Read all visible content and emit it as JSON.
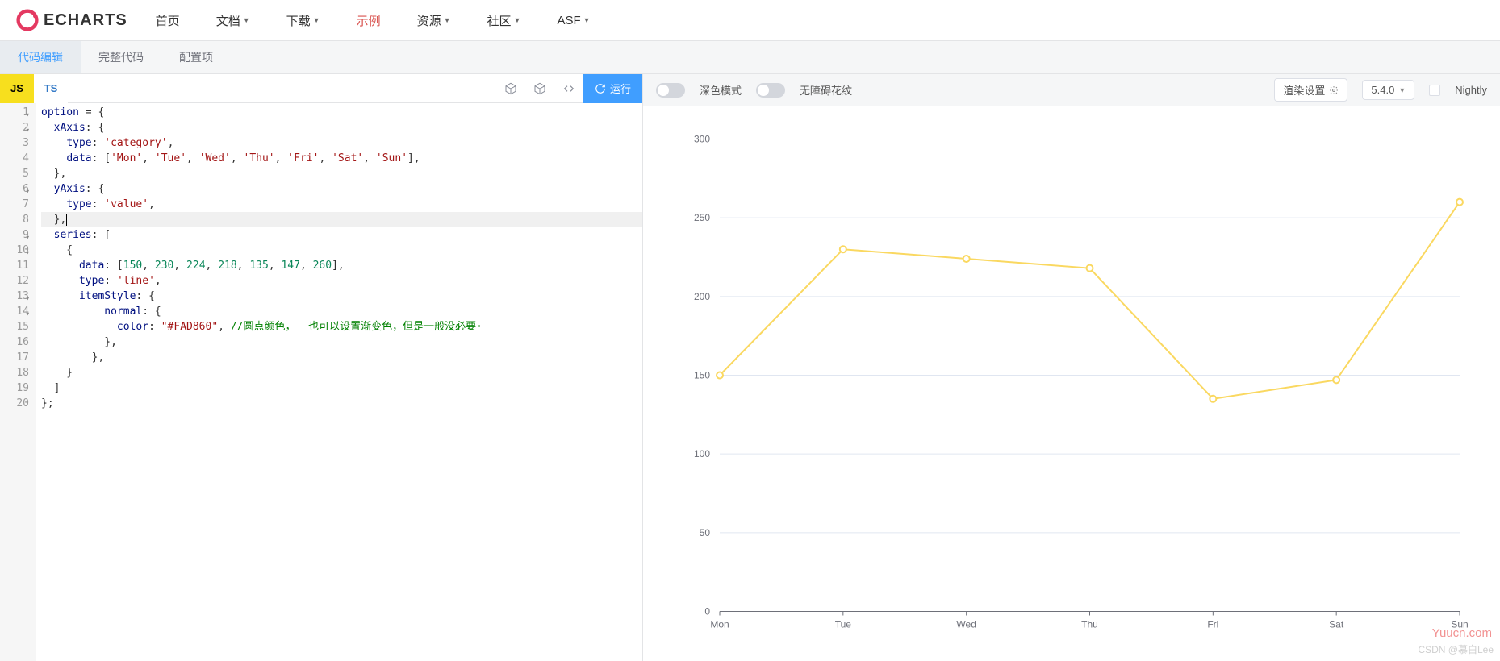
{
  "logo_text": "ECHARTS",
  "nav": {
    "home": "首页",
    "docs": "文档",
    "download": "下载",
    "examples": "示例",
    "resources": "资源",
    "community": "社区",
    "asf": "ASF"
  },
  "sub_tabs": {
    "code_edit": "代码编辑",
    "full_code": "完整代码",
    "config": "配置项"
  },
  "lang": {
    "js": "JS",
    "ts": "TS"
  },
  "run_label": "运行",
  "editor": {
    "line_count": 20,
    "highlighted_line": 8
  },
  "code_tokens": {
    "option": "option",
    "xAxis": "xAxis",
    "yAxis": "yAxis",
    "type": "type",
    "data": "data",
    "series": "series",
    "itemStyle": "itemStyle",
    "normal": "normal",
    "color": "color",
    "category": "'category'",
    "value_str": "'value'",
    "line_str": "'line'",
    "color_val": "\"#FAD860\"",
    "days": [
      "'Mon'",
      "'Tue'",
      "'Wed'",
      "'Thu'",
      "'Fri'",
      "'Sat'",
      "'Sun'"
    ],
    "nums": [
      "150",
      "230",
      "224",
      "218",
      "135",
      "147",
      "260"
    ],
    "comment": "//圆点颜色，  也可以设置渐变色，但是一般没必要·"
  },
  "settings": {
    "dark_mode": "深色模式",
    "decal": "无障碍花纹",
    "render": "渲染设置",
    "version": "5.4.0",
    "nightly": "Nightly"
  },
  "chart_data": {
    "type": "line",
    "categories": [
      "Mon",
      "Tue",
      "Wed",
      "Thu",
      "Fri",
      "Sat",
      "Sun"
    ],
    "values": [
      150,
      230,
      224,
      218,
      135,
      147,
      260
    ],
    "title": "",
    "xlabel": "",
    "ylabel": "",
    "yticks": [
      0,
      50,
      100,
      150,
      200,
      250,
      300
    ],
    "ylim": [
      0,
      300
    ],
    "line_color": "#FAD860"
  },
  "watermark1": "Yuucn.com",
  "watermark2": "CSDN @慕白Lee"
}
